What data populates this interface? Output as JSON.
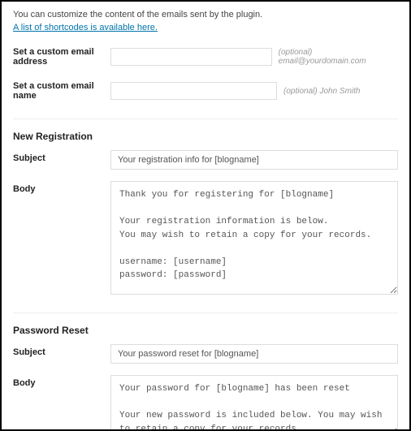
{
  "intro": {
    "text": "You can customize the content of the emails sent by the plugin.",
    "link": "A list of shortcodes is available here."
  },
  "custom_email": {
    "address_label": "Set a custom email address",
    "address_value": "",
    "address_hint": "(optional) email@yourdomain.com",
    "name_label": "Set a custom email name",
    "name_value": "",
    "name_hint": "(optional) John Smith"
  },
  "registration": {
    "section_title": "New Registration",
    "subject_label": "Subject",
    "subject_value": "Your registration info for [blogname]",
    "body_label": "Body",
    "body_value": "Thank you for registering for [blogname]\n\nYour registration information is below.\nYou may wish to retain a copy for your records.\n\nusername: [username]\npassword: [password]\n\nYou may login here:\n[reglink]\n\nYou may change your password here:\n[members-area]"
  },
  "reset": {
    "section_title": "Password Reset",
    "subject_label": "Subject",
    "subject_value": "Your password reset for [blogname]",
    "body_label": "Body",
    "body_value": "Your password for [blogname] has been reset\n\nYour new password is included below. You may wish to retain a copy for your records.\n\npassword: [password]"
  }
}
